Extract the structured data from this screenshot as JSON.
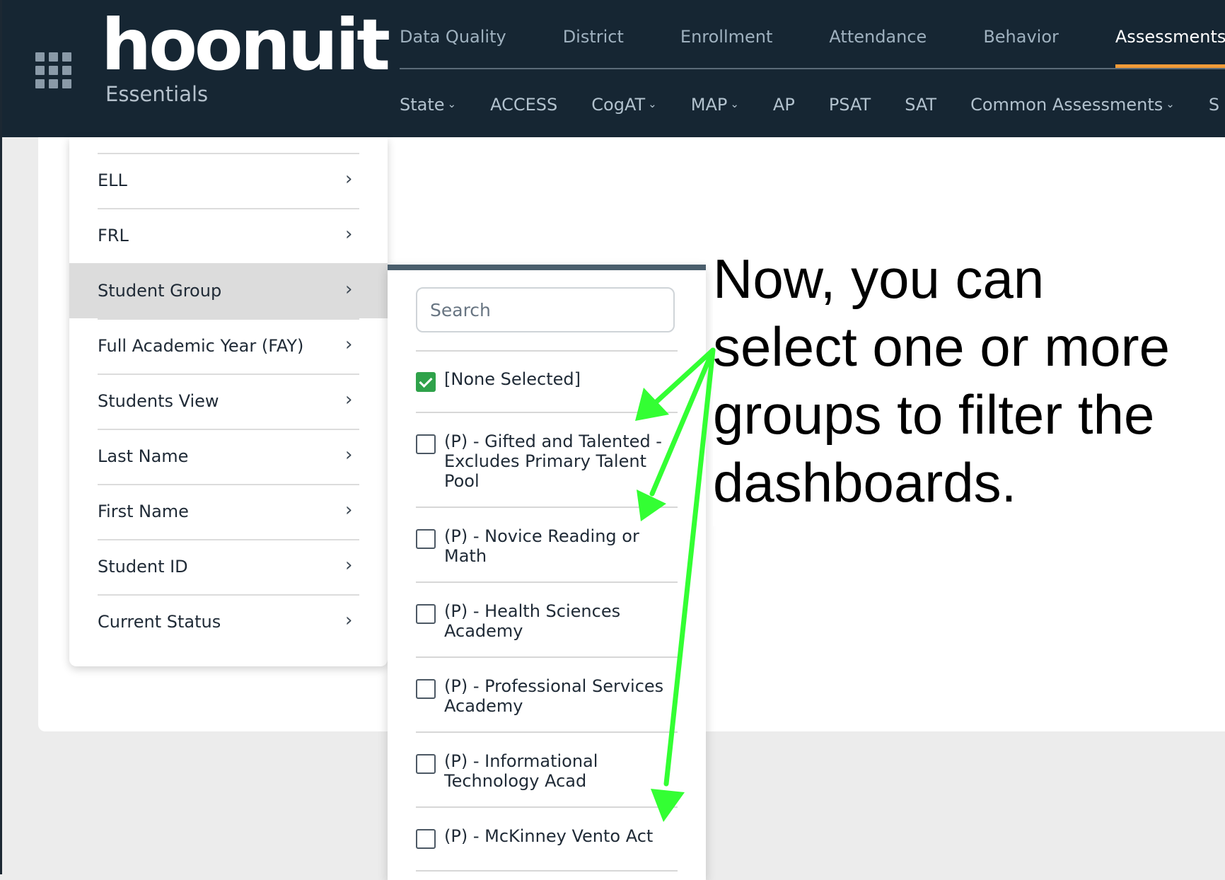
{
  "header": {
    "logo_text": "hoonuit",
    "logo_subtitle": "Essentials",
    "top_tabs": [
      {
        "label": "Data Quality"
      },
      {
        "label": "District"
      },
      {
        "label": "Enrollment"
      },
      {
        "label": "Attendance"
      },
      {
        "label": "Behavior"
      },
      {
        "label": "Assessments",
        "active": true
      }
    ],
    "sub_tabs": [
      {
        "label": "State",
        "dropdown": true
      },
      {
        "label": "ACCESS",
        "dropdown": false
      },
      {
        "label": "CogAT",
        "dropdown": true
      },
      {
        "label": "MAP",
        "dropdown": true
      },
      {
        "label": "AP",
        "dropdown": false
      },
      {
        "label": "PSAT",
        "dropdown": false
      },
      {
        "label": "SAT",
        "dropdown": false
      },
      {
        "label": "Common Assessments",
        "dropdown": true
      },
      {
        "label": "S",
        "dropdown": false
      }
    ],
    "accent_color": "#f29b38",
    "background_color": "#162633"
  },
  "filter_menu": {
    "items": [
      {
        "label": "ELL"
      },
      {
        "label": "FRL"
      },
      {
        "label": "Student Group",
        "selected": true
      },
      {
        "label": "Full Academic Year (FAY)"
      },
      {
        "label": "Students View"
      },
      {
        "label": "Last Name"
      },
      {
        "label": "First Name"
      },
      {
        "label": "Student ID"
      },
      {
        "label": "Current Status"
      }
    ]
  },
  "group_panel": {
    "search_placeholder": "Search",
    "options": [
      {
        "label": "[None Selected]",
        "checked": true
      },
      {
        "label": "(P) - Gifted and Talented - Excludes Primary Talent Pool",
        "checked": false
      },
      {
        "label": "(P) - Novice Reading or Math",
        "checked": false
      },
      {
        "label": "(P) - Health Sciences Academy",
        "checked": false
      },
      {
        "label": "(P) - Professional Services Academy",
        "checked": false
      },
      {
        "label": "(P) - Informational Technology Acad",
        "checked": false
      },
      {
        "label": "(P) - McKinney Vento Act",
        "checked": false
      }
    ],
    "check_color": "#2fa24a"
  },
  "annotation": {
    "text": "Now, you can select one or more groups to filter the dashboards.",
    "arrow_color": "#33ff33"
  }
}
